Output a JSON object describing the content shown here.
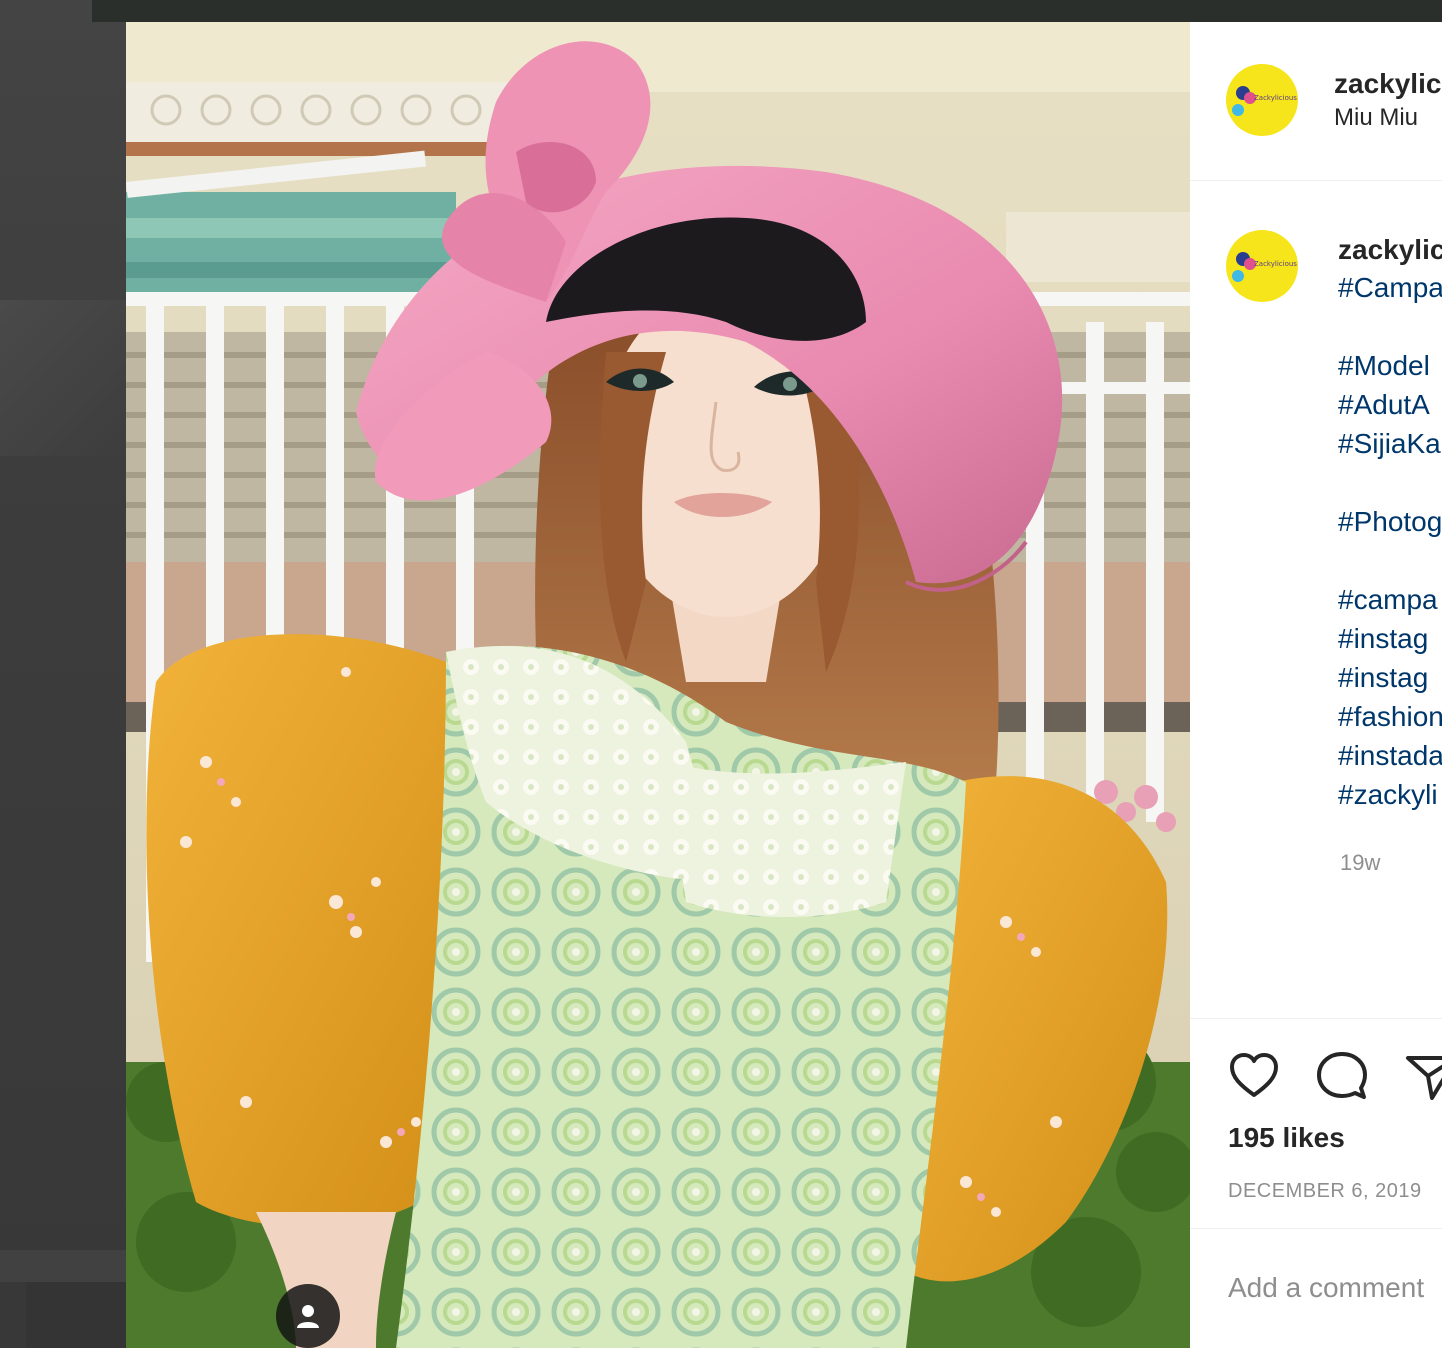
{
  "post": {
    "username": "zackylic",
    "location": "Miu Miu",
    "caption_username": "zackylic",
    "hashtags": [
      "#Campa",
      "#Model",
      "#AdutA",
      "#SijiaKa",
      "#Photog",
      "#campa",
      "#instag",
      "#instag",
      "#fashion",
      "#instada",
      "#zackyli"
    ],
    "age": "19w",
    "likes": "195 likes",
    "date": "DECEMBER 6, 2019",
    "comment_placeholder": "Add a comment"
  },
  "avatar": {
    "brand_color": "#f6e51a",
    "text": "Zackylicious"
  },
  "icons": {
    "heart": "heart-icon",
    "comment": "comment-bubble-icon",
    "share": "send-icon",
    "next": "chevron-right-icon",
    "tag": "person-icon"
  },
  "colors": {
    "hashtag": "#00376b",
    "text": "#262626",
    "muted": "#8e8e8e",
    "overlay": "#3b3b3b"
  }
}
